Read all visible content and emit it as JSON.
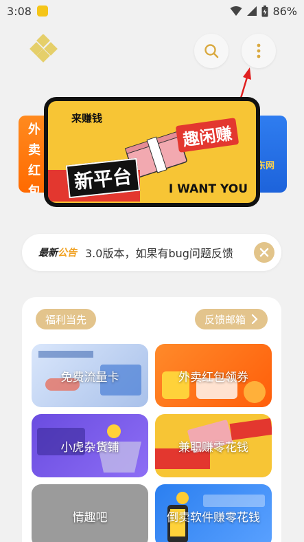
{
  "status_bar": {
    "time": "3:08",
    "battery": "86%"
  },
  "banner": {
    "tag": "来赚钱",
    "title": "趣闲赚",
    "main": "新平台",
    "slogan": "I WANT YOU",
    "left_peek": "外卖红包",
    "right_peek": "东网"
  },
  "notice": {
    "label_a": "最新",
    "label_b": "公告",
    "text": "3.0版本，如果有bug问题反馈"
  },
  "panel": {
    "welfare_label": "福利当先",
    "feedback_label": "反馈邮箱",
    "tiles": [
      {
        "label": "免费流量卡"
      },
      {
        "label": "外卖红包领券"
      },
      {
        "label": "小虎杂货铺"
      },
      {
        "label": "兼职赚零花钱"
      },
      {
        "label": "情趣吧"
      },
      {
        "label": "倒卖软件赚零花钱"
      }
    ]
  },
  "colors": {
    "accent_gold": "#e3c48c",
    "banner_yellow": "#f7c535",
    "banner_red": "#e3372f"
  },
  "icons": [
    "app-logo-icon",
    "search-icon",
    "more-vertical-icon",
    "close-icon",
    "chevron-right-icon"
  ]
}
